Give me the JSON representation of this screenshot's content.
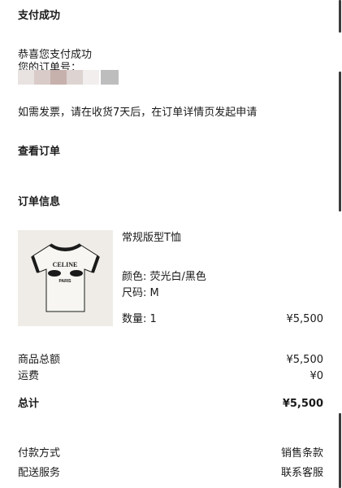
{
  "header": {
    "title": "支付成功"
  },
  "payment": {
    "congrats": "恭喜您支付成功",
    "order_number_label": "您的订单号：",
    "invoice_note": "如需发票，请在收货7天后，在订单详情页发起申请"
  },
  "view_order_label": "查看订单",
  "order_info": {
    "title": "订单信息",
    "product": {
      "name": "常规版型T恤",
      "image_brand": "CELINE",
      "image_sub": "PARIS",
      "color_label": "颜色: 荧光白/黑色",
      "size_label": "尺码: M",
      "quantity_label": "数量: 1",
      "price": "¥5,500"
    }
  },
  "summary": {
    "subtotal_label": "商品总额",
    "subtotal_value": "¥5,500",
    "shipping_label": "运费",
    "shipping_value": "¥0",
    "total_label": "总计",
    "total_value": "¥5,500"
  },
  "footer_links": {
    "payment_method": "付款方式",
    "sales_terms": "销售条款",
    "delivery_service": "配送服务",
    "contact_service": "联系客服"
  },
  "colors": {
    "background": "#ffffff",
    "text": "#1a1a1a",
    "image_bg": "#efece7",
    "scrollbar": "#3c3c3c"
  }
}
